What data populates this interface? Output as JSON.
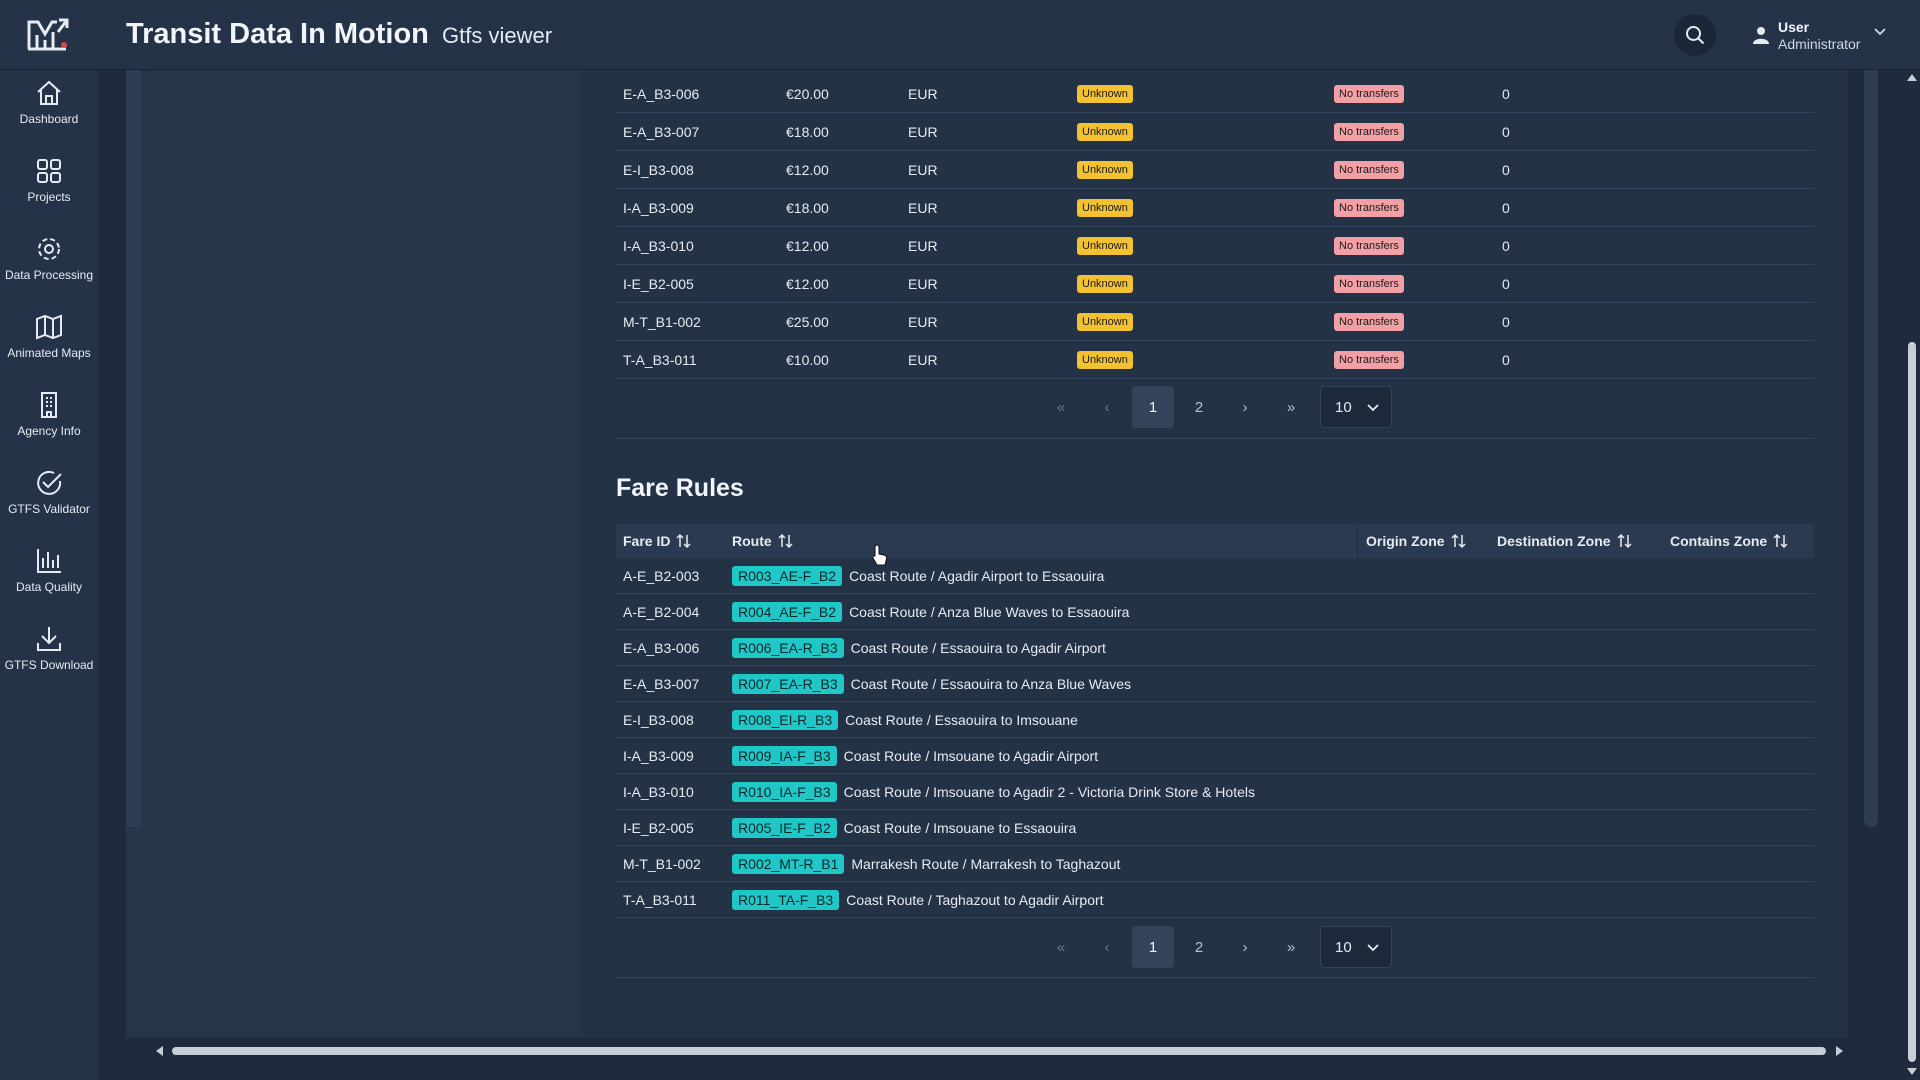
{
  "header": {
    "title": "Transit Data In Motion",
    "subtitle": "Gtfs viewer",
    "user_name": "User",
    "user_role": "Administrator"
  },
  "sidebar": {
    "items": [
      {
        "label": "Dashboard",
        "icon": "home-icon"
      },
      {
        "label": "Projects",
        "icon": "grid-icon"
      },
      {
        "label": "Data Processing",
        "icon": "gear-icon"
      },
      {
        "label": "Animated Maps",
        "icon": "map-icon"
      },
      {
        "label": "Agency Info",
        "icon": "building-icon"
      },
      {
        "label": "GTFS Validator",
        "icon": "check-circle-icon"
      },
      {
        "label": "Data Quality",
        "icon": "bar-chart-icon"
      },
      {
        "label": "GTFS Download",
        "icon": "download-icon"
      }
    ]
  },
  "fare_attributes": {
    "rows": [
      {
        "id": "E-A_B3-006",
        "price": "€20.00",
        "currency": "EUR",
        "payment": "Unknown",
        "transfers": "No transfers",
        "duration": "0"
      },
      {
        "id": "E-A_B3-007",
        "price": "€18.00",
        "currency": "EUR",
        "payment": "Unknown",
        "transfers": "No transfers",
        "duration": "0"
      },
      {
        "id": "E-I_B3-008",
        "price": "€12.00",
        "currency": "EUR",
        "payment": "Unknown",
        "transfers": "No transfers",
        "duration": "0"
      },
      {
        "id": "I-A_B3-009",
        "price": "€18.00",
        "currency": "EUR",
        "payment": "Unknown",
        "transfers": "No transfers",
        "duration": "0"
      },
      {
        "id": "I-A_B3-010",
        "price": "€12.00",
        "currency": "EUR",
        "payment": "Unknown",
        "transfers": "No transfers",
        "duration": "0"
      },
      {
        "id": "I-E_B2-005",
        "price": "€12.00",
        "currency": "EUR",
        "payment": "Unknown",
        "transfers": "No transfers",
        "duration": "0"
      },
      {
        "id": "M-T_B1-002",
        "price": "€25.00",
        "currency": "EUR",
        "payment": "Unknown",
        "transfers": "No transfers",
        "duration": "0"
      },
      {
        "id": "T-A_B3-011",
        "price": "€10.00",
        "currency": "EUR",
        "payment": "Unknown",
        "transfers": "No transfers",
        "duration": "0"
      }
    ],
    "pagination": {
      "first": "«",
      "prev": "‹",
      "pages": [
        "1",
        "2"
      ],
      "next": "›",
      "last": "»",
      "per_page": "10"
    }
  },
  "fare_rules": {
    "title": "Fare Rules",
    "columns": {
      "fare_id": "Fare ID",
      "route": "Route",
      "origin": "Origin Zone",
      "destination": "Destination Zone",
      "contains": "Contains Zone"
    },
    "rows": [
      {
        "id": "A-E_B2-003",
        "route_id": "R003_AE-F_B2",
        "route_name": "Coast Route / Agadir Airport to Essaouira"
      },
      {
        "id": "A-E_B2-004",
        "route_id": "R004_AE-F_B2",
        "route_name": "Coast Route / Anza Blue Waves to Essaouira"
      },
      {
        "id": "E-A_B3-006",
        "route_id": "R006_EA-R_B3",
        "route_name": "Coast Route / Essaouira to Agadir Airport"
      },
      {
        "id": "E-A_B3-007",
        "route_id": "R007_EA-R_B3",
        "route_name": "Coast Route / Essaouira to Anza Blue Waves"
      },
      {
        "id": "E-I_B3-008",
        "route_id": "R008_EI-R_B3",
        "route_name": "Coast Route / Essaouira to Imsouane"
      },
      {
        "id": "I-A_B3-009",
        "route_id": "R009_IA-F_B3",
        "route_name": "Coast Route / Imsouane to Agadir Airport"
      },
      {
        "id": "I-A_B3-010",
        "route_id": "R010_IA-F_B3",
        "route_name": "Coast Route / Imsouane to Agadir 2 - Victoria Drink Store & Hotels"
      },
      {
        "id": "I-E_B2-005",
        "route_id": "R005_IE-F_B2",
        "route_name": "Coast Route / Imsouane to Essaouira"
      },
      {
        "id": "M-T_B1-002",
        "route_id": "R002_MT-R_B1",
        "route_name": "Marrakesh Route / Marrakesh to Taghazout"
      },
      {
        "id": "T-A_B3-011",
        "route_id": "R011_TA-F_B3",
        "route_name": "Coast Route / Taghazout to Agadir Airport"
      }
    ],
    "pagination": {
      "first": "«",
      "prev": "‹",
      "pages": [
        "1",
        "2"
      ],
      "next": "›",
      "last": "»",
      "per_page": "10"
    }
  },
  "colors": {
    "background": "#1f2b3d",
    "panel": "#243347",
    "badge_unknown": "#f2c233",
    "badge_no_transfers": "#f2a0a6",
    "route_badge": "#20c7c7"
  }
}
